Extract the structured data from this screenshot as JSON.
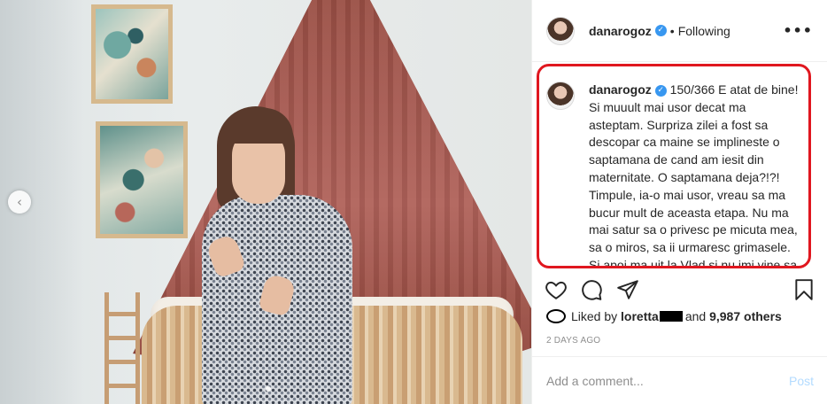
{
  "post": {
    "username": "danarogoz",
    "verified_icon": "verified-badge-icon",
    "separator": "•",
    "follow_status": "Following",
    "more_label": "•••"
  },
  "caption": {
    "username": "danarogoz",
    "text": "150/366 E atat de bine! Si muuult mai usor decat ma asteptam. Surpriza zilei a fost sa descopar ca maine se implineste o saptamana de cand am iesit din maternitate. O saptamana deja?!?! Timpule, ia-o mai usor, vreau sa ma bucur mult de aceasta etapa. Nu ma mai satur sa o privesc pe micuta mea, sa o miros, sa ii urmaresc grimasele. Si apoi ma uit la Vlad si nu imi vine sa"
  },
  "actions": {
    "like_icon": "heart-icon",
    "comment_icon": "comment-icon",
    "share_icon": "share-icon",
    "save_icon": "bookmark-icon"
  },
  "likes": {
    "prefix": "Liked by",
    "first_user": "loretta",
    "connector": "and",
    "others": "9,987 others"
  },
  "timestamp": "2 DAYS AGO",
  "comment": {
    "placeholder": "Add a comment...",
    "post_label": "Post"
  },
  "carousel": {
    "prev_label": "‹"
  },
  "colors": {
    "highlight_border": "#e0171f",
    "verified": "#3897f0",
    "post_disabled": "#b3dbff"
  }
}
